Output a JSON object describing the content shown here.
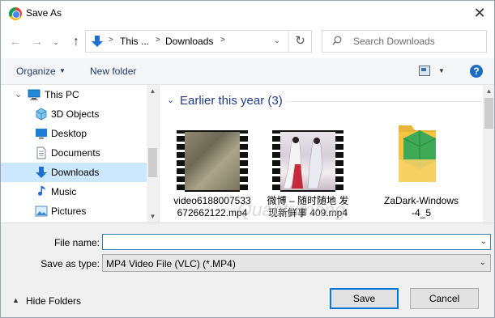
{
  "window": {
    "title": "Save As",
    "close_glyph": "✕"
  },
  "nav": {
    "back_glyph": "←",
    "forward_glyph": "→",
    "recent_glyph": "⌄",
    "up_glyph": "↑",
    "breadcrumb": [
      "This ...",
      "Downloads"
    ],
    "separators": [
      ">",
      ">",
      ">"
    ],
    "dropdown_glyph": "⌄",
    "refresh_glyph": "↻",
    "search_placeholder": "Search Downloads"
  },
  "toolbar": {
    "organize_label": "Organize",
    "organize_arrow": "▼",
    "new_folder_label": "New folder",
    "view_arrow": "▼",
    "help_glyph": "?"
  },
  "sidebar": {
    "items": [
      {
        "label": "This PC",
        "icon": "computer-icon",
        "root": true,
        "chevron": "⌄"
      },
      {
        "label": "3D Objects",
        "icon": "cube-icon"
      },
      {
        "label": "Desktop",
        "icon": "desktop-icon"
      },
      {
        "label": "Documents",
        "icon": "document-icon"
      },
      {
        "label": "Downloads",
        "icon": "download-icon",
        "selected": true
      },
      {
        "label": "Music",
        "icon": "music-note-icon"
      },
      {
        "label": "Pictures",
        "icon": "pictures-icon"
      }
    ],
    "scroll_up": "▲",
    "scroll_down": "▼"
  },
  "content": {
    "group_chevron": "⌄",
    "group_title": "Earlier this year (3)",
    "files": [
      {
        "name": "video6188007533 672662122.mp4",
        "type": "video"
      },
      {
        "name": "微博 – 随时随地 发现新鲜事 409.mp4",
        "type": "video"
      },
      {
        "name": "ZaDark-Windows -4_5",
        "type": "folder"
      }
    ],
    "scroll_up": "▲"
  },
  "form": {
    "file_name_label": "File name:",
    "file_name_value": "",
    "file_name_dd": "⌄",
    "save_type_label": "Save as type:",
    "save_type_value": "MP4 Video File (VLC) (*.MP4)",
    "save_type_dd": "⌄",
    "hide_folders_arrow": "▲",
    "hide_folders_label": "Hide Folders",
    "save_label": "Save",
    "cancel_label": "Cancel"
  },
  "watermark": "Quantrimang",
  "colors": {
    "accent": "#0078d7",
    "selected": "#cce8ff",
    "link": "#1e3a8a",
    "folder": "#f4c542"
  }
}
